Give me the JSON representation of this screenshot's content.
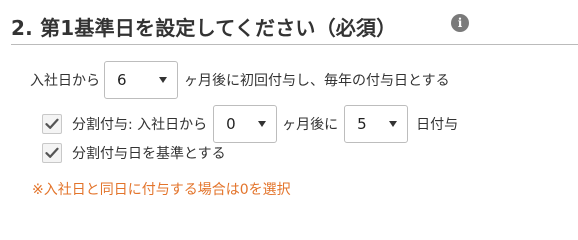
{
  "section": {
    "title": "2. 第1基準日を設定してください（必須）",
    "info_icon_glyph": "i",
    "info_icon": "info-circle-icon"
  },
  "first_grant": {
    "prefix": "入社日から",
    "months_value": "6",
    "suffix": "ヶ月後に初回付与し、毎年の付与日とする"
  },
  "split_grant": {
    "checked": true,
    "label": "分割付与: 入社日から",
    "months_value": "0",
    "months_suffix": "ヶ月後に",
    "day_value": "5",
    "day_suffix": "日付与"
  },
  "base_date_option": {
    "checked": true,
    "label": "分割付与日を基準とする"
  },
  "note": {
    "text": "※入社日と同日に付与する場合は0を選択",
    "color": "#e3742b"
  },
  "colors": {
    "title": "#333333",
    "info_icon_bg": "#7a7a7a",
    "checkmark": "#555555"
  }
}
